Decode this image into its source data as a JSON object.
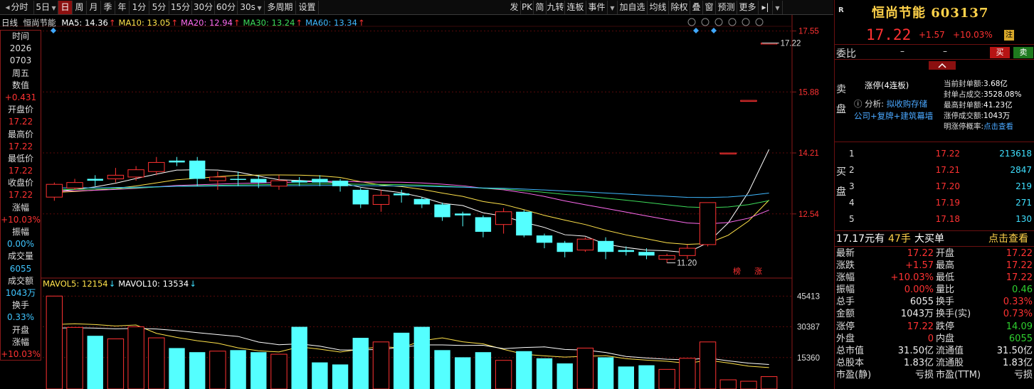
{
  "toolbar": {
    "left": [
      {
        "label": "分时",
        "icon": "arrow-left-icon"
      },
      {
        "label": "5日",
        "dropdown": true
      },
      {
        "label": "日",
        "active": true
      },
      {
        "label": "周"
      },
      {
        "label": "月"
      },
      {
        "label": "季"
      },
      {
        "label": "年"
      },
      {
        "label": "1分"
      },
      {
        "label": "5分"
      },
      {
        "label": "15分"
      },
      {
        "label": "30分"
      },
      {
        "label": "60分"
      },
      {
        "label": "30s",
        "dropdown": true
      },
      {
        "label": "多周期"
      },
      {
        "label": "设置"
      }
    ],
    "right": [
      "发",
      "PK",
      "简",
      "九转",
      "连板",
      "事件",
      "加自选",
      "均线",
      "除权",
      "叠",
      "窗",
      "预测",
      "更多"
    ]
  },
  "chart_header": {
    "period": "日线",
    "stock_name": "恒尚节能",
    "ma": [
      {
        "label": "MA5: 14.36",
        "color": "#ffffff"
      },
      {
        "label": "MA10: 13.05",
        "color": "#ffe24a"
      },
      {
        "label": "MA20: 12.94",
        "color": "#ff6bf0"
      },
      {
        "label": "MA30: 13.24",
        "color": "#3ddc5a"
      },
      {
        "label": "MA60: 13.34",
        "color": "#3fb8ff"
      }
    ],
    "vol": [
      {
        "label": "MAVOL5: 12154",
        "color": "#ffe24a"
      },
      {
        "label": "MAVOL10: 13534",
        "color": "#ffffff"
      }
    ]
  },
  "left_panel": [
    {
      "t": "时间",
      "c": "label"
    },
    {
      "t": "2026",
      "c": "label"
    },
    {
      "t": "0703",
      "c": "label"
    },
    {
      "t": "周五",
      "c": "label"
    },
    {
      "t": "数值",
      "c": "label"
    },
    {
      "t": "+0.431",
      "c": "red"
    },
    {
      "t": "开盘价",
      "c": "label"
    },
    {
      "t": "17.22",
      "c": "red"
    },
    {
      "t": "最高价",
      "c": "label"
    },
    {
      "t": "17.22",
      "c": "red"
    },
    {
      "t": "最低价",
      "c": "label"
    },
    {
      "t": "17.22",
      "c": "red"
    },
    {
      "t": "收盘价",
      "c": "label"
    },
    {
      "t": "17.22",
      "c": "red"
    },
    {
      "t": "涨幅",
      "c": "label"
    },
    {
      "t": "+10.03%",
      "c": "red"
    },
    {
      "t": "振幅",
      "c": "label"
    },
    {
      "t": "0.00%",
      "c": "cyan"
    },
    {
      "t": "成交量",
      "c": "label"
    },
    {
      "t": "6055",
      "c": "cyan"
    },
    {
      "t": "成交额",
      "c": "label"
    },
    {
      "t": "1043万",
      "c": "cyan"
    },
    {
      "t": "换手",
      "c": "label"
    },
    {
      "t": "0.33%",
      "c": "cyan"
    },
    {
      "t": "开盘",
      "c": "label"
    },
    {
      "t": "涨幅",
      "c": "label"
    },
    {
      "t": "+10.03%",
      "c": "red"
    }
  ],
  "chart_data": {
    "type": "candlestick",
    "price_axis": {
      "ticks": [
        17.55,
        15.88,
        14.21,
        12.54
      ],
      "range": [
        10.9,
        17.6
      ]
    },
    "volume_axis": {
      "ticks": [
        45413,
        30387,
        15360
      ],
      "range": [
        0,
        49000
      ]
    },
    "annotations": {
      "high": "17.22",
      "low": "11.20",
      "badges": [
        "榜",
        "涨"
      ]
    },
    "candles": [
      {
        "o": 13.0,
        "c": 13.35,
        "h": 13.4,
        "l": 12.9,
        "v": 45413
      },
      {
        "o": 13.25,
        "c": 13.4,
        "h": 13.5,
        "l": 13.2,
        "v": 30100
      },
      {
        "o": 13.5,
        "c": 13.45,
        "h": 13.6,
        "l": 13.3,
        "v": 26000
      },
      {
        "o": 13.5,
        "c": 13.6,
        "h": 13.8,
        "l": 13.4,
        "v": 24500
      },
      {
        "o": 13.55,
        "c": 13.75,
        "h": 13.85,
        "l": 13.45,
        "v": 30387
      },
      {
        "o": 13.7,
        "c": 13.95,
        "h": 14.1,
        "l": 13.6,
        "v": 25000
      },
      {
        "o": 14.0,
        "c": 13.95,
        "h": 14.1,
        "l": 13.85,
        "v": 20000
      },
      {
        "o": 14.0,
        "c": 13.5,
        "h": 14.1,
        "l": 13.3,
        "v": 18000
      },
      {
        "o": 13.45,
        "c": 13.55,
        "h": 13.7,
        "l": 13.2,
        "v": 18500
      },
      {
        "o": 13.5,
        "c": 13.48,
        "h": 13.7,
        "l": 13.3,
        "v": 19000
      },
      {
        "o": 13.5,
        "c": 13.4,
        "h": 13.6,
        "l": 13.25,
        "v": 18000
      },
      {
        "o": 13.3,
        "c": 13.45,
        "h": 13.6,
        "l": 13.2,
        "v": 17000
      },
      {
        "o": 13.45,
        "c": 13.4,
        "h": 13.55,
        "l": 13.3,
        "v": 30387
      },
      {
        "o": 13.5,
        "c": 13.4,
        "h": 13.6,
        "l": 13.3,
        "v": 13000
      },
      {
        "o": 13.45,
        "c": 13.3,
        "h": 13.5,
        "l": 13.15,
        "v": 12000
      },
      {
        "o": 13.2,
        "c": 12.8,
        "h": 13.25,
        "l": 12.7,
        "v": 25000
      },
      {
        "o": 12.8,
        "c": 13.05,
        "h": 13.2,
        "l": 12.6,
        "v": 23000
      },
      {
        "o": 13.1,
        "c": 13.05,
        "h": 13.2,
        "l": 12.85,
        "v": 27500
      },
      {
        "o": 12.95,
        "c": 12.8,
        "h": 13.0,
        "l": 12.7,
        "v": 30387
      },
      {
        "o": 12.8,
        "c": 12.45,
        "h": 12.85,
        "l": 12.35,
        "v": 19000
      },
      {
        "o": 12.55,
        "c": 12.5,
        "h": 12.6,
        "l": 12.2,
        "v": 15500
      },
      {
        "o": 12.45,
        "c": 12.05,
        "h": 12.5,
        "l": 11.9,
        "v": 18000
      },
      {
        "o": 12.25,
        "c": 12.6,
        "h": 12.7,
        "l": 12.0,
        "v": 14000
      },
      {
        "o": 12.6,
        "c": 11.95,
        "h": 12.65,
        "l": 11.9,
        "v": 18500
      },
      {
        "o": 11.95,
        "c": 11.75,
        "h": 12.0,
        "l": 11.6,
        "v": 15000
      },
      {
        "o": 11.75,
        "c": 11.5,
        "h": 11.8,
        "l": 11.35,
        "v": 12500
      },
      {
        "o": 11.55,
        "c": 11.85,
        "h": 11.9,
        "l": 11.5,
        "v": 20000
      },
      {
        "o": 11.8,
        "c": 11.5,
        "h": 11.9,
        "l": 11.3,
        "v": 15500
      },
      {
        "o": 11.55,
        "c": 11.5,
        "h": 11.65,
        "l": 11.4,
        "v": 11000
      },
      {
        "o": 11.5,
        "c": 11.4,
        "h": 11.6,
        "l": 11.3,
        "v": 11600
      },
      {
        "o": 11.3,
        "c": 11.4,
        "h": 11.45,
        "l": 11.2,
        "v": 9600
      },
      {
        "o": 11.4,
        "c": 11.6,
        "h": 11.7,
        "l": 11.3,
        "v": 15000
      },
      {
        "o": 11.7,
        "c": 12.85,
        "h": 12.85,
        "l": 11.65,
        "v": 23000
      },
      {
        "o": 14.21,
        "c": 14.21,
        "h": 14.21,
        "l": 14.21,
        "v": 4500
      },
      {
        "o": 15.65,
        "c": 15.65,
        "h": 15.65,
        "l": 15.65,
        "v": 3800
      },
      {
        "o": 17.22,
        "c": 17.22,
        "h": 17.22,
        "l": 17.22,
        "v": 6055
      }
    ]
  },
  "stock": {
    "market_badge": "R",
    "name_code": "恒尚节能 603137",
    "price": "17.22",
    "change": "+1.57",
    "pct": "+10.03%",
    "badge": "注"
  },
  "weibi": {
    "label": "委比",
    "v1": "–",
    "v2": "–",
    "buy": "买",
    "sell": "卖"
  },
  "zhangting": {
    "title": "涨停(4连板)",
    "analysis_prefix": "分析:",
    "analysis_text": "拟收购存储",
    "analysis_line2": "公司+复牌+建筑幕墙",
    "stats": [
      {
        "k": "当前封单额:",
        "v": "3.68亿"
      },
      {
        "k": "封单占成交:",
        "v": "3528.08%"
      },
      {
        "k": "最高封单额:",
        "v": "41.23亿"
      },
      {
        "k": "涨停成交额:",
        "v": "1043万"
      },
      {
        "k": "明涨停概率:",
        "v": "点击查看",
        "link": true
      }
    ]
  },
  "sell_label": "卖盘",
  "buy_label": "买盘",
  "bids": [
    {
      "lv": "1",
      "p": "17.22",
      "v": "213618"
    },
    {
      "lv": "2",
      "p": "17.21",
      "v": "2847"
    },
    {
      "lv": "3",
      "p": "17.20",
      "v": "219"
    },
    {
      "lv": "4",
      "p": "17.19",
      "v": "271"
    },
    {
      "lv": "5",
      "p": "17.18",
      "v": "130"
    }
  ],
  "big_buy": {
    "price": "17.17元有",
    "qty": "47手",
    "label": "大买单",
    "link": "点击查看"
  },
  "stats": [
    [
      "最新",
      "17.22",
      "red",
      "开盘",
      "17.22",
      "red"
    ],
    [
      "涨跌",
      "+1.57",
      "red",
      "最高",
      "17.22",
      "red"
    ],
    [
      "涨幅",
      "+10.03%",
      "red",
      "最低",
      "17.22",
      "red"
    ],
    [
      "振幅",
      "0.00%",
      "red",
      "量比",
      "0.46",
      "green"
    ],
    [
      "总手",
      "6055",
      "white",
      "换手",
      "0.33%",
      "red"
    ],
    [
      "金额",
      "1043万",
      "white",
      "换手(实)",
      "0.73%",
      "red"
    ],
    [
      "涨停",
      "17.22",
      "red",
      "跌停",
      "14.09",
      "green"
    ],
    [
      "外盘",
      "0",
      "red",
      "内盘",
      "6055",
      "green"
    ],
    [
      "总市值",
      "31.50亿",
      "white",
      "流通值",
      "31.50亿",
      "white"
    ],
    [
      "总股本",
      "1.83亿",
      "white",
      "流通股",
      "1.83亿",
      "white"
    ],
    [
      "市盈(静)",
      "亏损",
      "white",
      "市盈(TTM)",
      "亏损",
      "white"
    ]
  ]
}
